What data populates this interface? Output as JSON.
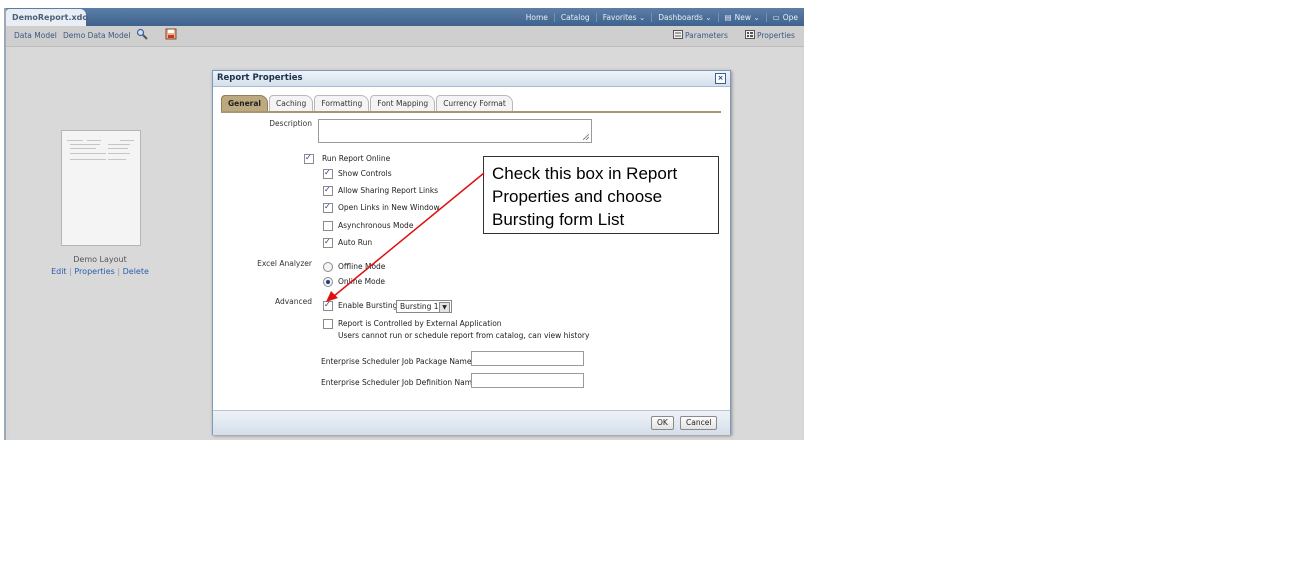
{
  "document_tab": "DemoReport.xdo",
  "top_nav": [
    {
      "icon": "",
      "label": "Home"
    },
    {
      "icon": "",
      "label": "Catalog"
    },
    {
      "icon": "",
      "label": "Favorites ⌄"
    },
    {
      "icon": "",
      "label": "Dashboards ⌄"
    },
    {
      "icon": "new-icon",
      "label": "New ⌄"
    },
    {
      "icon": "open-folder-icon",
      "label": "Ope"
    }
  ],
  "toolbar": {
    "data_model_label": "Data Model",
    "data_model_value": "Demo Data Model",
    "parameters_label": "Parameters",
    "properties_label": "Properties"
  },
  "layout": {
    "name": "Demo Layout",
    "edit": "Edit",
    "properties": "Properties",
    "delete": "Delete",
    "separator": "|"
  },
  "dialog": {
    "title": "Report Properties",
    "tabs": [
      "General",
      "Caching",
      "Formatting",
      "Font Mapping",
      "Currency Format"
    ],
    "active_tab": "General",
    "description_label": "Description",
    "description_value": "",
    "run_online": {
      "label": "Run Report Online",
      "checked": true
    },
    "online_options": [
      {
        "label": "Show Controls",
        "checked": true
      },
      {
        "label": "Allow Sharing Report Links",
        "checked": true
      },
      {
        "label": "Open Links in New Window",
        "checked": true
      },
      {
        "label": "Asynchronous Mode",
        "checked": false
      },
      {
        "label": "Auto Run",
        "checked": true
      }
    ],
    "excel_analyzer_label": "Excel Analyzer",
    "excel_modes": [
      {
        "label": "Offline Mode",
        "selected": false
      },
      {
        "label": "Online Mode",
        "selected": true
      }
    ],
    "advanced_label": "Advanced",
    "enable_bursting": {
      "label": "Enable Bursting",
      "checked": true,
      "selected_value": "Bursting 1"
    },
    "external_app": {
      "label": "Report is Controlled by External Application",
      "checked": false,
      "note": "Users cannot run or schedule report from catalog, can view history"
    },
    "job_package_label": "Enterprise Scheduler Job Package Name",
    "job_package_value": "",
    "job_definition_label": "Enterprise Scheduler Job Definition Name",
    "job_definition_value": "",
    "ok_label": "OK",
    "cancel_label": "Cancel",
    "close_glyph": "×"
  },
  "callout": {
    "lines": [
      "Check this box in Report",
      "Properties and choose",
      "Bursting form List"
    ],
    "arrow_color": "#e01010"
  }
}
